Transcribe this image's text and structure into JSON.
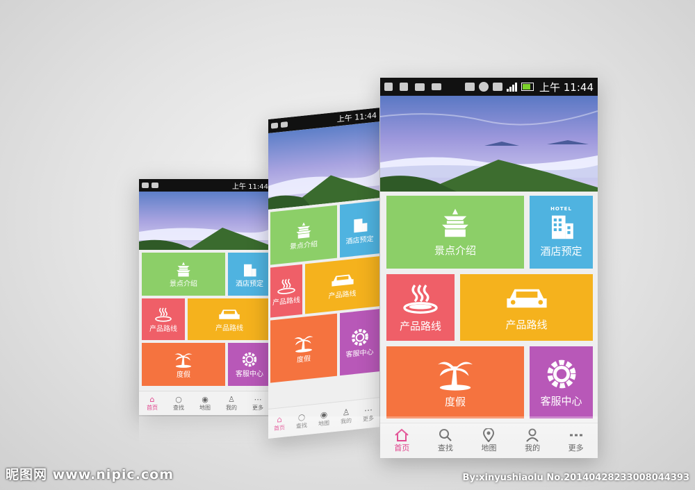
{
  "status": {
    "time": "上午 11:44"
  },
  "tiles": [
    {
      "id": "scenic",
      "label": "景点介绍",
      "icon": "temple-icon",
      "color": "#8ccf68"
    },
    {
      "id": "hotel",
      "label": "酒店预定",
      "icon": "hotel-icon",
      "color": "#4fb3e0"
    },
    {
      "id": "route1",
      "label": "产品路线",
      "icon": "hot-spring-icon",
      "color": "#ef5f68"
    },
    {
      "id": "route2",
      "label": "产品路线",
      "icon": "car-icon",
      "color": "#f5b21d"
    },
    {
      "id": "vacation",
      "label": "度假",
      "icon": "palm-tree-icon",
      "color": "#f5733f"
    },
    {
      "id": "service",
      "label": "客服中心",
      "icon": "gear-icon",
      "color": "#b858b8"
    }
  ],
  "nav": [
    {
      "label": "首页",
      "icon": "home-icon",
      "active": true
    },
    {
      "label": "查找",
      "icon": "search-icon",
      "active": false
    },
    {
      "label": "地图",
      "icon": "map-pin-icon",
      "active": false
    },
    {
      "label": "我的",
      "icon": "user-icon",
      "active": false
    },
    {
      "label": "更多",
      "icon": "more-icon",
      "active": false
    }
  ],
  "hotel_sign": "HOTEL",
  "watermark": {
    "site": "昵图网 www.nipic.com",
    "credit": "By:xinyushiaolu  No.20140428233008044393"
  }
}
